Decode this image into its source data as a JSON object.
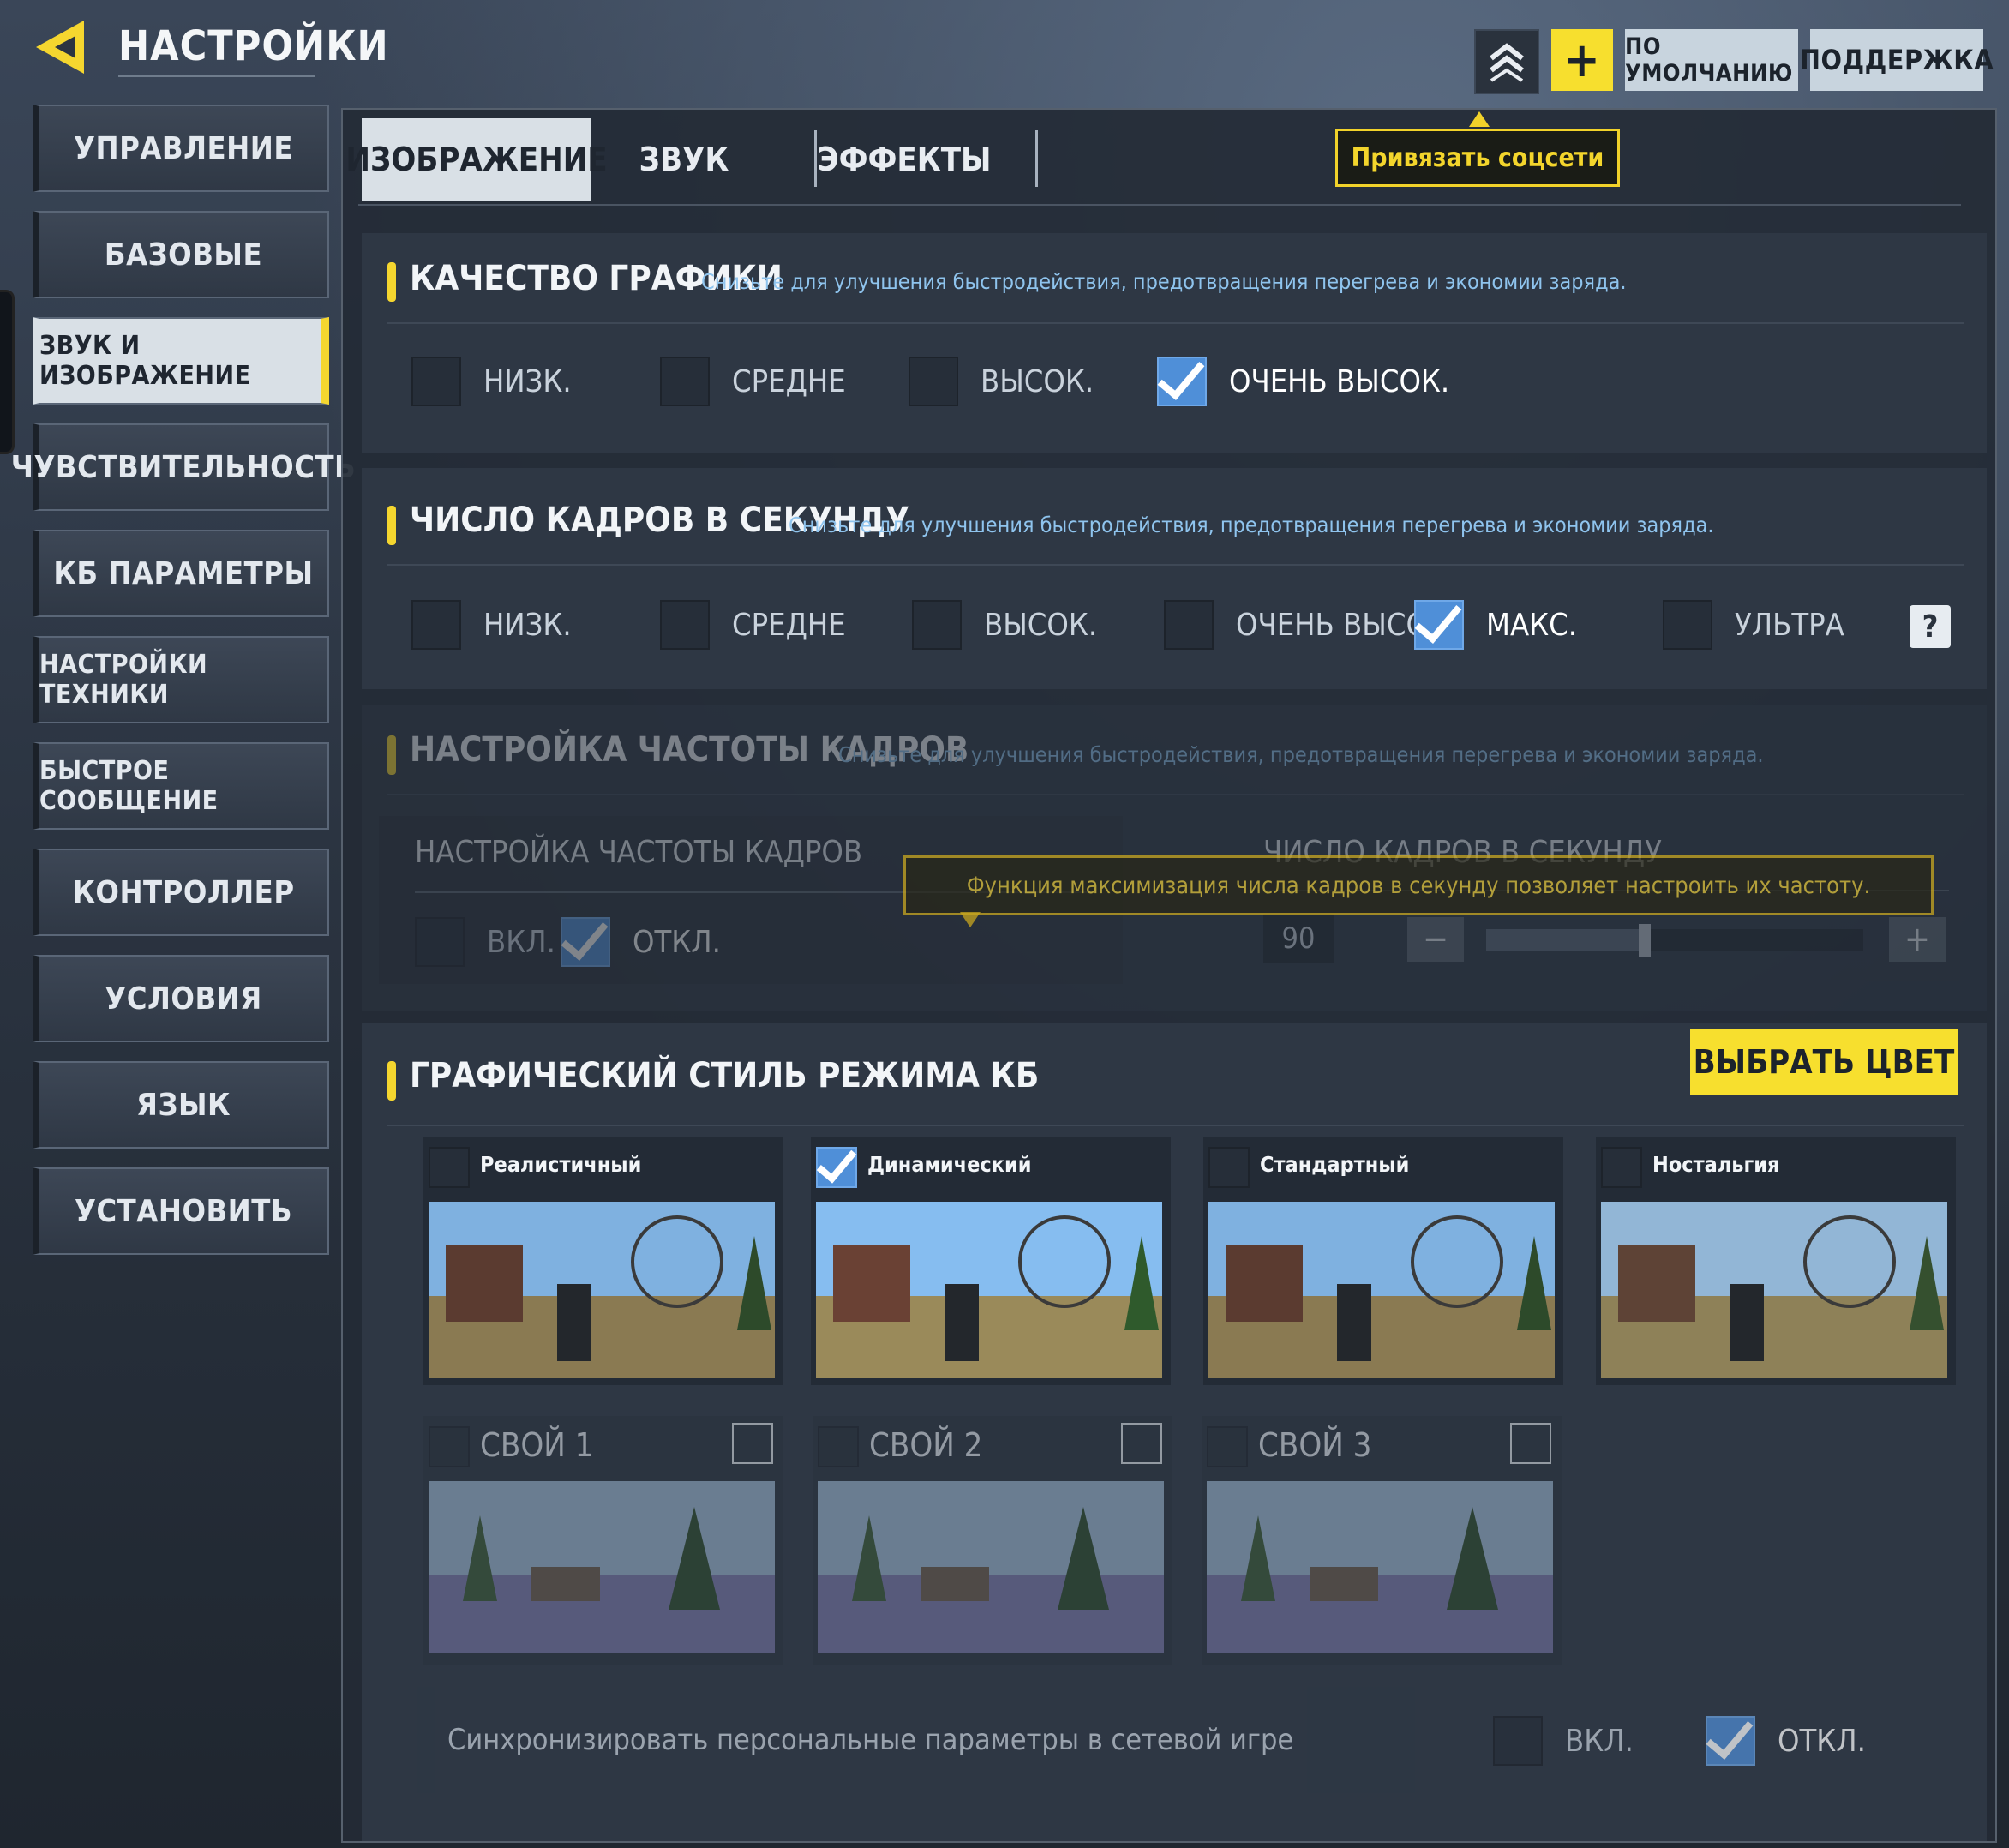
{
  "header": {
    "title": "НАСТРОЙКИ",
    "buttons": {
      "plus": "+",
      "default": "ПО УМОЛЧАНИЮ",
      "support": "ПОДДЕРЖКА"
    }
  },
  "sidebar": {
    "items": [
      {
        "label": "УПРАВЛЕНИЕ"
      },
      {
        "label": "БАЗОВЫЕ"
      },
      {
        "label": "ЗВУК И ИЗОБРАЖЕНИЕ",
        "active": true
      },
      {
        "label": "ЧУВСТВИТЕЛЬНОСТЬ"
      },
      {
        "label": "КБ ПАРАМЕТРЫ"
      },
      {
        "label": "НАСТРОЙКИ ТЕХНИКИ"
      },
      {
        "label": "БЫСТРОЕ СООБЩЕНИЕ"
      },
      {
        "label": "КОНТРОЛЛЕР"
      },
      {
        "label": "УСЛОВИЯ"
      },
      {
        "label": "ЯЗЫК"
      },
      {
        "label": "УСТАНОВИТЬ"
      }
    ]
  },
  "tabs": [
    {
      "label": "ИЗОБРАЖЕНИЕ",
      "active": true
    },
    {
      "label": "ЗВУК"
    },
    {
      "label": "ЭФФЕКТЫ"
    }
  ],
  "bind_social": "Привязать соцсети",
  "graphics_quality": {
    "title": "КАЧЕСТВО ГРАФИКИ",
    "hint": "Снизьте для улучшения быстродействия, предотвращения перегрева и экономии заряда.",
    "options": [
      {
        "label": "НИЗК.",
        "checked": false
      },
      {
        "label": "СРЕДНЕ",
        "checked": false
      },
      {
        "label": "ВЫСОК.",
        "checked": false
      },
      {
        "label": "ОЧЕНЬ ВЫСОК.",
        "checked": true
      }
    ]
  },
  "fps": {
    "title": "ЧИСЛО КАДРОВ В СЕКУНДУ",
    "hint": "Снизьте для улучшения быстродействия, предотвращения перегрева и экономии заряда.",
    "options": [
      {
        "label": "НИЗК.",
        "checked": false
      },
      {
        "label": "СРЕДНЕ",
        "checked": false
      },
      {
        "label": "ВЫСОК.",
        "checked": false
      },
      {
        "label": "ОЧЕНЬ ВЫСОК.",
        "checked": false
      },
      {
        "label": "МАКС.",
        "checked": true
      },
      {
        "label": "УЛЬТРА",
        "checked": false
      }
    ],
    "help": "?"
  },
  "frame_rate": {
    "title": "НАСТРОЙКА ЧАСТОТЫ КАДРОВ",
    "hint": "Снизьте для улучшения быстродействия, предотвращения перегрева и экономии заряда.",
    "tooltip": "Функция максимизация числа кадров в секунду позволяет настроить их частоту.",
    "toggle_title": "НАСТРОЙКА ЧАСТОТЫ КАДРОВ",
    "on_label": "ВКЛ.",
    "off_label": "ОТКЛ.",
    "enabled": false,
    "fps_title": "ЧИСЛО КАДРОВ В СЕКУНДУ",
    "fps_value": "90",
    "minus": "−",
    "plus": "+",
    "slider_fraction": 0.42
  },
  "br_style": {
    "title": "ГРАФИЧЕСКИЙ СТИЛЬ РЕЖИМА КБ",
    "pick_color": "ВЫБРАТЬ ЦВЕТ",
    "styles": [
      {
        "label": "Реалистичный",
        "checked": false
      },
      {
        "label": "Динамический",
        "checked": true
      },
      {
        "label": "Стандартный",
        "checked": false
      },
      {
        "label": "Ностальгия",
        "checked": false
      }
    ],
    "custom": [
      {
        "label": "СВОЙ 1"
      },
      {
        "label": "СВОЙ 2"
      },
      {
        "label": "СВОЙ 3"
      }
    ]
  },
  "sync": {
    "label": "Синхронизировать персональные параметры в сетевой игре",
    "on_label": "ВКЛ.",
    "off_label": "ОТКЛ.",
    "enabled": false
  },
  "colors": {
    "accent": "#f5d62f",
    "check": "#4f8fd8",
    "hint": "#8fc4ee"
  }
}
